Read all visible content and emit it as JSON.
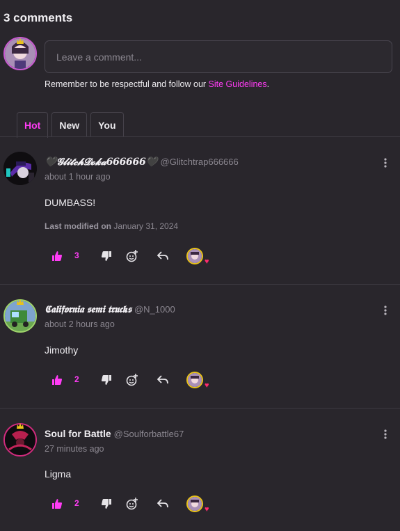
{
  "header": {
    "title": "3 comments"
  },
  "composer": {
    "placeholder": "Leave a comment...",
    "notice_before": "Remember to be respectful and follow our ",
    "notice_link": "Site Guidelines",
    "notice_after": "."
  },
  "tabs": [
    {
      "label": "Hot",
      "active": true
    },
    {
      "label": "New",
      "active": false
    },
    {
      "label": "You",
      "active": false
    }
  ],
  "comments": [
    {
      "display_name": "🖤𝓖𝓵𝓲𝓽𝓬𝓱𝓓𝓸𝓴𝓪666666🖤",
      "handle": "@Glitchtrap666666",
      "time": "about 1 hour ago",
      "text": "DUMBASS!",
      "modified_label": "Last modified on",
      "modified_date": "January 31, 2024",
      "likes": "3"
    },
    {
      "display_name": "𝕮𝖆𝖑𝖎𝖋𝖔𝖗𝖓𝖎𝖆 𝖘𝖊𝖒𝖎 𝖙𝖗𝖚𝖈𝖐𝖘",
      "handle": "@N_1000",
      "time": "about 2 hours ago",
      "text": "Jimothy",
      "likes": "2"
    },
    {
      "display_name": "Soul for Battle",
      "handle": "@Soulforbattle67",
      "time": "27 minutes ago",
      "text": "Ligma",
      "likes": "2"
    }
  ],
  "icons": {
    "like": "thumbs-up-icon",
    "dislike": "thumbs-down-icon",
    "react": "add-reaction-icon",
    "reply": "reply-icon",
    "more": "more-options-icon"
  },
  "colors": {
    "accent": "#ff3cf5",
    "background": "#29262c",
    "heart": "#ff2a6d"
  }
}
